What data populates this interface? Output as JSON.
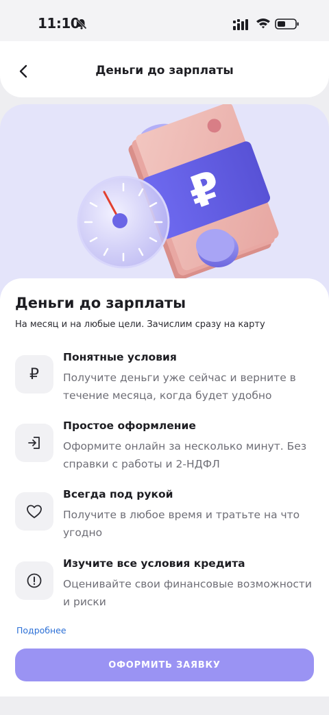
{
  "status": {
    "time": "11:10"
  },
  "header": {
    "title": "Деньги до зарплаты",
    "back_icon": "chevron-left-icon"
  },
  "hero": {
    "currency_symbol": "₽"
  },
  "card": {
    "title": "Деньги до зарплаты",
    "subtitle": "На месяц и на любые цели. Зачислим сразу на карту",
    "features": [
      {
        "icon": "ruble-icon",
        "icon_glyph": "₽",
        "title": "Понятные условия",
        "text": "Получите деньги уже сейчас и верните в течение месяца, когда будет удобно"
      },
      {
        "icon": "sign-in-icon",
        "title": "Простое оформление",
        "text": "Оформите онлайн за несколько минут. Без справки с работы и 2-НДФЛ"
      },
      {
        "icon": "heart-icon",
        "title": "Всегда под рукой",
        "text": "Получите в любое время и тратьте на что угодно"
      },
      {
        "icon": "info-icon",
        "title": "Изучите все условия кредита",
        "text": "Оценивайте свои финансовые возможности и риски"
      }
    ],
    "more_link": "Подробнее",
    "submit_label": "ОФОРМИТЬ ЗАЯВКУ"
  },
  "colors": {
    "accent": "#9a93f3",
    "hero_bg": "#e4e4fa",
    "link": "#2b6fd6"
  }
}
